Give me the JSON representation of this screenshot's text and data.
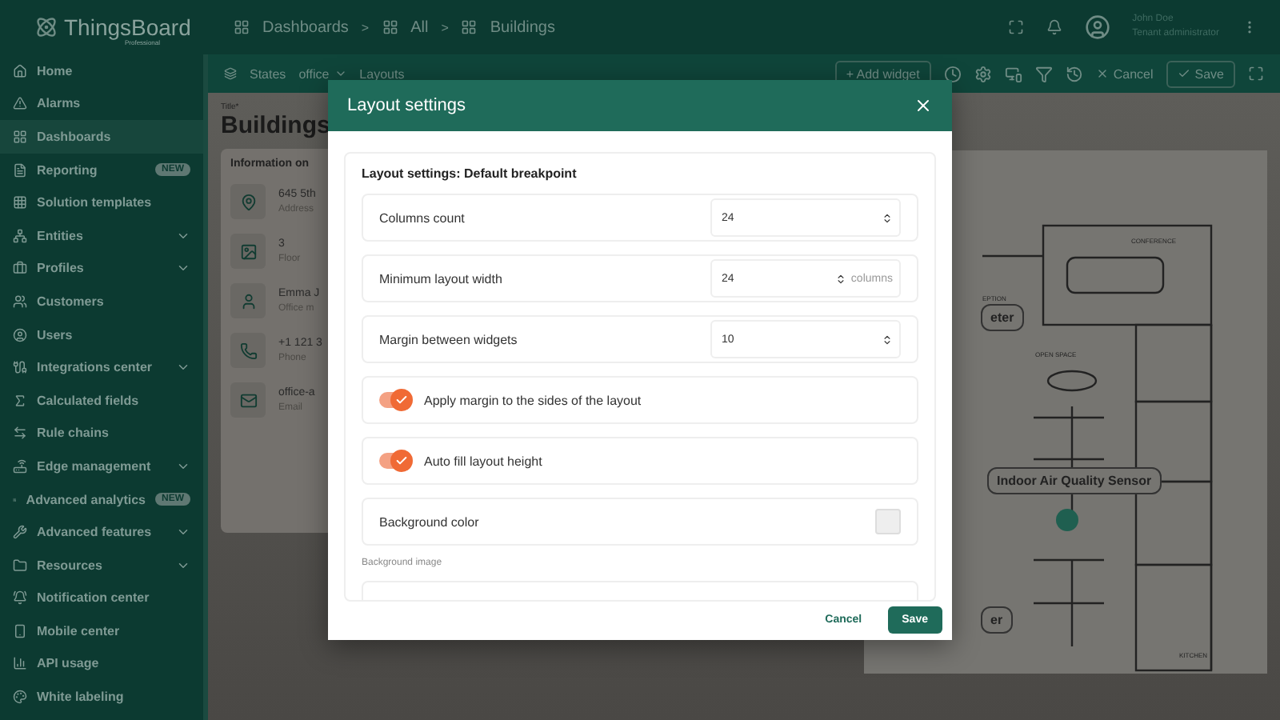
{
  "header": {
    "logo": "ThingsBoard",
    "logo_sub": "Professional",
    "breadcrumbs": [
      "Dashboards",
      "All",
      "Buildings"
    ],
    "separator": ">",
    "user": {
      "name": "John Doe",
      "role": "Tenant administrator"
    }
  },
  "sidebar": {
    "items": [
      {
        "label": "Home",
        "selected": false
      },
      {
        "label": "Alarms",
        "selected": false
      },
      {
        "label": "Dashboards",
        "selected": true
      },
      {
        "label": "Reporting",
        "selected": false,
        "badge": "NEW"
      },
      {
        "label": "Solution templates",
        "selected": false
      },
      {
        "label": "Entities",
        "selected": false,
        "expandable": true
      },
      {
        "label": "Profiles",
        "selected": false,
        "expandable": true
      },
      {
        "label": "Customers",
        "selected": false
      },
      {
        "label": "Users",
        "selected": false
      },
      {
        "label": "Integrations center",
        "selected": false,
        "expandable": true
      },
      {
        "label": "Calculated fields",
        "selected": false
      },
      {
        "label": "Rule chains",
        "selected": false
      },
      {
        "label": "Edge management",
        "selected": false,
        "expandable": true
      },
      {
        "label": "Advanced analytics",
        "selected": false,
        "badge": "NEW"
      },
      {
        "label": "Advanced features",
        "selected": false,
        "expandable": true
      },
      {
        "label": "Resources",
        "selected": false,
        "expandable": true
      },
      {
        "label": "Notification center",
        "selected": false
      },
      {
        "label": "Mobile center",
        "selected": false
      },
      {
        "label": "API usage",
        "selected": false
      },
      {
        "label": "White labeling",
        "selected": false
      }
    ]
  },
  "toolbar": {
    "states_label": "States",
    "state_value": "office",
    "layouts": "Layouts",
    "add_widget": "+ Add widget",
    "cancel": "Cancel",
    "save": "Save"
  },
  "dashboard": {
    "title_label": "Title*",
    "title": "Buildings",
    "info_card": {
      "title": "Information on",
      "rows": [
        {
          "value": "645 5th",
          "label": "Address"
        },
        {
          "value": "3",
          "label": "Floor"
        },
        {
          "value": "Emma J",
          "label": "Office m"
        },
        {
          "value": "+1 121 3",
          "label": "Phone"
        },
        {
          "value": "office-a",
          "label": "Email"
        }
      ]
    },
    "floor_plan": {
      "rooms": [
        "CONFERENCE",
        "EPTION",
        "OPEN SPACE",
        "KITCHEN"
      ],
      "markers": [
        "eter",
        "Indoor Air Quality Sensor",
        "er"
      ]
    }
  },
  "dialog": {
    "title": "Layout settings",
    "section_title": "Layout settings: Default breakpoint",
    "rows": [
      {
        "kind": "number",
        "label": "Columns count",
        "value": "24"
      },
      {
        "kind": "number",
        "label": "Minimum layout width",
        "value": "24",
        "suffix": "columns"
      },
      {
        "kind": "number",
        "label": "Margin between widgets",
        "value": "10"
      },
      {
        "kind": "toggle",
        "label": "Apply margin to the sides of the layout",
        "on": true
      },
      {
        "kind": "toggle",
        "label": "Auto fill layout height",
        "on": true
      },
      {
        "kind": "color",
        "label": "Background color"
      }
    ],
    "background_image_label": "Background image",
    "cancel": "Cancel",
    "save": "Save"
  }
}
